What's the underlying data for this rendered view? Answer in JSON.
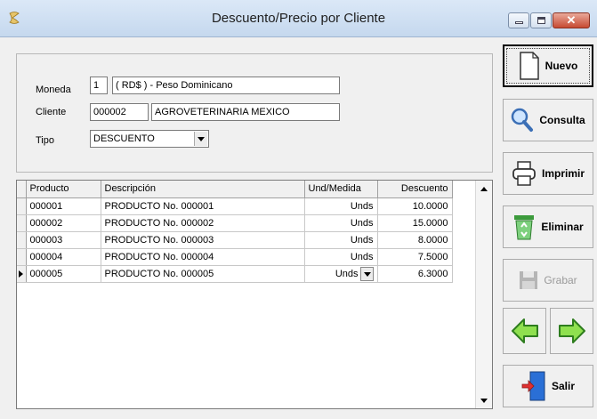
{
  "window": {
    "title": "Descuento/Precio por Cliente"
  },
  "form": {
    "moneda_label": "Moneda",
    "moneda_code": "1",
    "moneda_desc": "( RD$ ) - Peso Dominicano",
    "cliente_label": "Cliente",
    "cliente_code": "000002",
    "cliente_name": "AGROVETERINARIA MEXICO",
    "tipo_label": "Tipo",
    "tipo_value": "DESCUENTO"
  },
  "grid": {
    "columns": [
      "Producto",
      "Descripción",
      "Und/Medida",
      "Descuento"
    ],
    "rows": [
      {
        "producto": "000001",
        "descripcion": "PRODUCTO No. 000001",
        "unidad": "Unds",
        "descuento": "10.0000"
      },
      {
        "producto": "000002",
        "descripcion": "PRODUCTO No. 000002",
        "unidad": "Unds",
        "descuento": "15.0000"
      },
      {
        "producto": "000003",
        "descripcion": "PRODUCTO No. 000003",
        "unidad": "Unds",
        "descuento": "8.0000"
      },
      {
        "producto": "000004",
        "descripcion": "PRODUCTO No. 000004",
        "unidad": "Unds",
        "descuento": "7.5000"
      },
      {
        "producto": "000005",
        "descripcion": "PRODUCTO No. 000005",
        "unidad": "Unds",
        "descuento": "6.3000"
      }
    ]
  },
  "buttons": {
    "nuevo": "Nuevo",
    "consulta": "Consulta",
    "imprimir": "Imprimir",
    "eliminar": "Eliminar",
    "grabar": "Grabar",
    "salir": "Salir"
  },
  "colors": {
    "arrow_green": "#7cd13f",
    "eliminar_green": "#4caf50",
    "door_blue": "#2a6fd6",
    "close_red": "#c74a32"
  }
}
